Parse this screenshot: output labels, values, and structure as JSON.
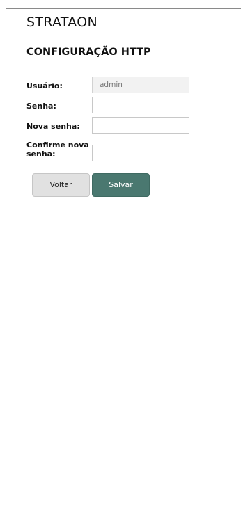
{
  "brand": {
    "name": "STRATAON"
  },
  "page": {
    "title": "CONFIGURAÇÃO HTTP"
  },
  "form": {
    "username_label": "Usuário:",
    "username_value": "admin",
    "password_label": "Senha:",
    "password_value": "",
    "new_password_label": "Nova senha:",
    "new_password_value": "",
    "confirm_password_label": "Confirme nova senha:",
    "confirm_password_value": ""
  },
  "actions": {
    "back_label": "Voltar",
    "save_label": "Salvar"
  },
  "colors": {
    "accent": "#4a7870",
    "secondary_button": "#e1e1e1"
  }
}
